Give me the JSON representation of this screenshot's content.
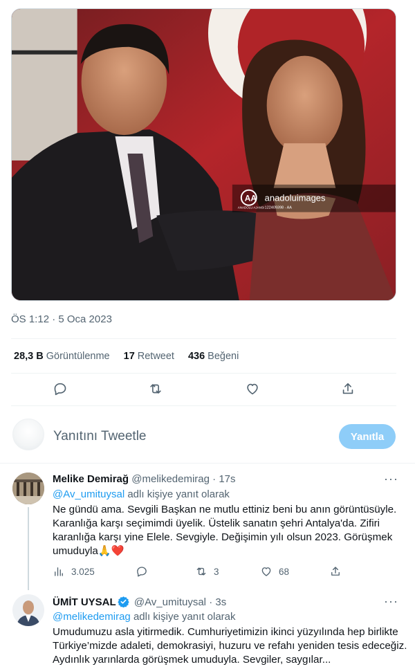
{
  "main_tweet": {
    "photo": {
      "watermark_brand": "anadoluimages",
      "watermark_agency": "ANADOLU AJANSI",
      "watermark_id": "122409398 - AA"
    },
    "timestamp": "ÖS 1:12 · 5 Oca 2023",
    "stats": [
      {
        "value": "28,3 B",
        "label": "Görüntülenme"
      },
      {
        "value": "17",
        "label": "Retweet"
      },
      {
        "value": "436",
        "label": "Beğeni"
      }
    ],
    "actions": [
      "reply-icon",
      "retweet-icon",
      "like-icon",
      "share-icon"
    ]
  },
  "reply_box": {
    "placeholder": "Yanıtını Tweetle",
    "button_label": "Yanıtla"
  },
  "replies": [
    {
      "name": "Melike Demirağ",
      "handle": "@melikedemirag",
      "time": "· 17s",
      "replying_mention": "@Av_umituysal",
      "replying_suffix": "adlı kişiye yanıt olarak",
      "lines": [
        "Ne gündü ama. Sevgili Başkan ne mutlu ettiniz beni bu anın görüntüsüyle.",
        "Karanlığa karşı  seçimimdi üyelik. Üstelik sanatın şehri Antalya'da. Zifiri",
        "karanlığa karşı yine Elele. Sevgiyle. Değişimin yılı olsun 2023. Görüşmek",
        "umuduyla🙏❤️"
      ],
      "views": "3.025",
      "retweets": "3",
      "likes": "68"
    },
    {
      "name": "ÜMİT UYSAL",
      "handle": "@Av_umituysal",
      "time": "· 3s",
      "verified": true,
      "replying_mention": "@melikedemirag",
      "replying_suffix": "adlı kişiye yanıt olarak",
      "lines": [
        "Umudumuzu asla yitirmedik. Cumhuriyetimizin ikinci yüzyılında hep birlikte",
        "Türkiye’mizde adaleti, demokrasiyi, huzuru ve refahı yeniden tesis edeceğiz.",
        "Aydınlık yarınlarda görüşmek umuduyla. Sevgiler, saygılar..."
      ]
    }
  ],
  "colors": {
    "accent": "#1d9bf0",
    "button_disabled": "#8ecdf8",
    "like_heart": "#e0245e",
    "flag_red": "#b4252a"
  }
}
